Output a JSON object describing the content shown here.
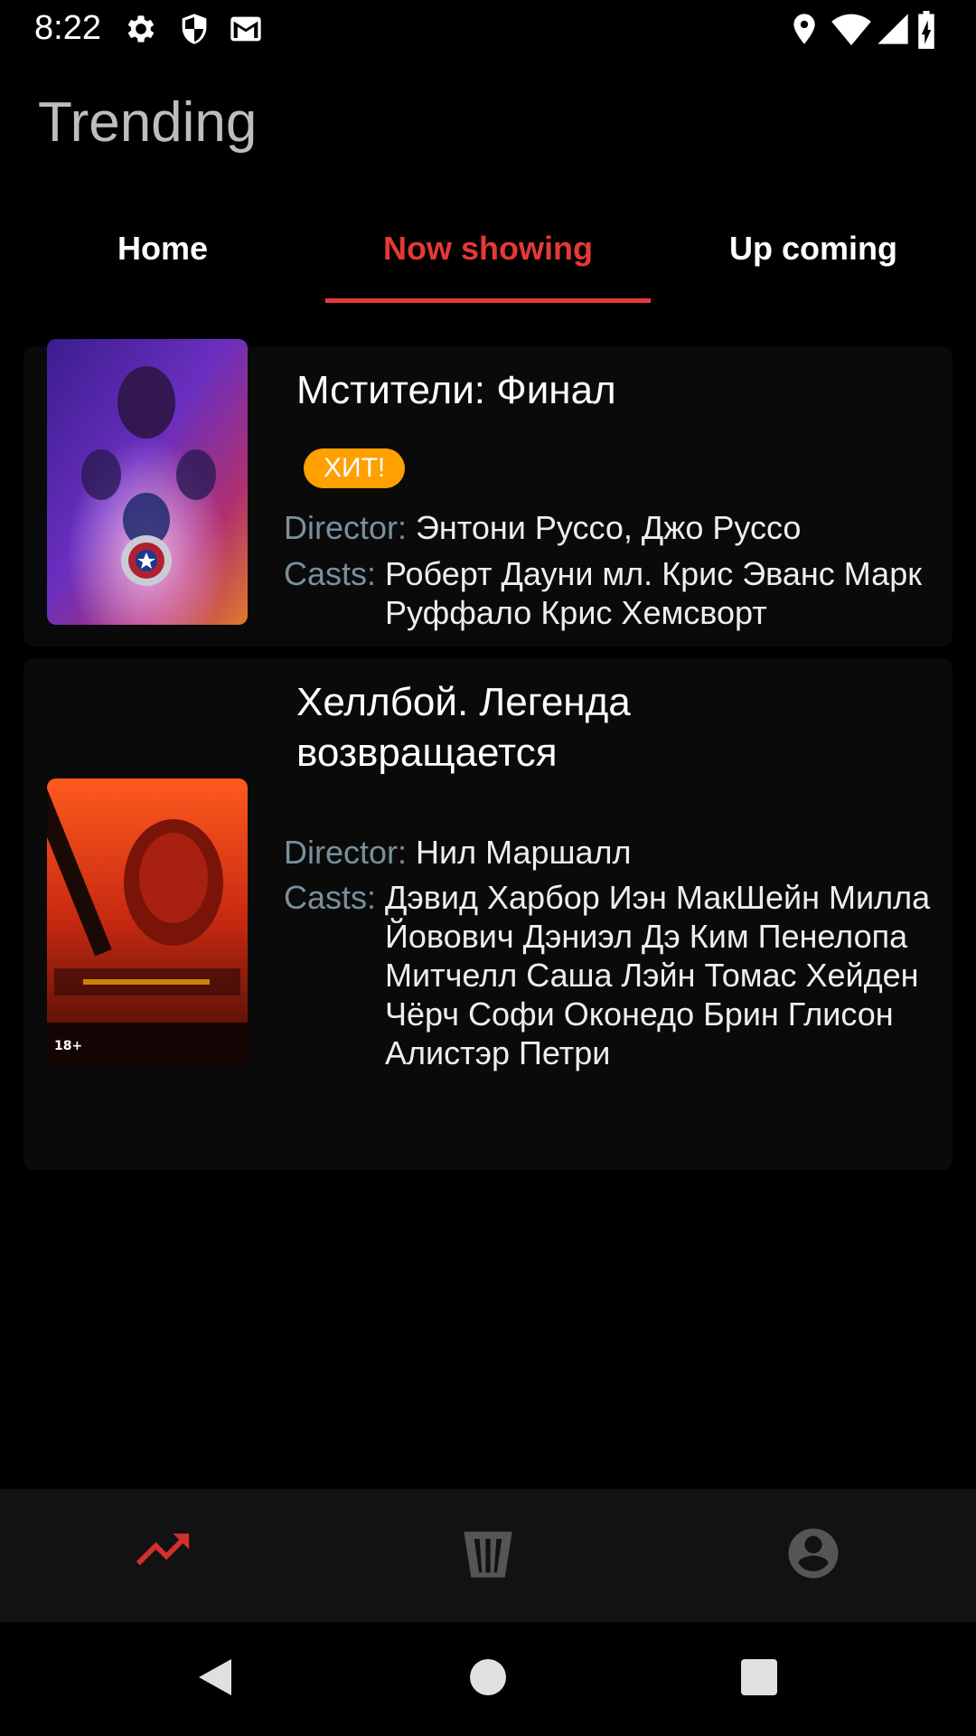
{
  "status_bar": {
    "time": "8:22",
    "icons_left": [
      "gear-icon",
      "shield-icon",
      "gmail-icon"
    ],
    "icons_right": [
      "location-icon",
      "wifi-icon",
      "signal-icon",
      "battery-charging-icon"
    ]
  },
  "header": {
    "title": "Trending"
  },
  "tabs": [
    {
      "label": "Home",
      "active": false
    },
    {
      "label": "Now showing",
      "active": true
    },
    {
      "label": "Up coming",
      "active": false
    }
  ],
  "movies": [
    {
      "title": "Мстители: Финал",
      "badge": "ХИТ!",
      "director_label": "Director:",
      "director": "Энтони Руссо, Джо Руссо",
      "casts_label": "Casts:",
      "casts": "Роберт Дауни мл. Крис Эванс Марк Руффало Крис Хемсворт"
    },
    {
      "title": "Хеллбой. Легенда возвращается",
      "director_label": "Director:",
      "director": "Нил Маршалл",
      "casts_label": "Casts:",
      "casts": "Дэвид Харбор Иэн МакШейн Милла Йовович Дэниэл Дэ Ким Пенелопа Митчелл Саша Лэйн Томас Хейден Чёрч Софи Оконедо Брин Глисон Алистэр Петри"
    }
  ],
  "bottom_nav": [
    {
      "icon": "trending-icon",
      "active": true
    },
    {
      "icon": "popcorn-icon",
      "active": false
    },
    {
      "icon": "account-icon",
      "active": false
    }
  ],
  "colors": {
    "accent": "#e53935",
    "badge": "#ffa000",
    "label": "#78909c"
  }
}
